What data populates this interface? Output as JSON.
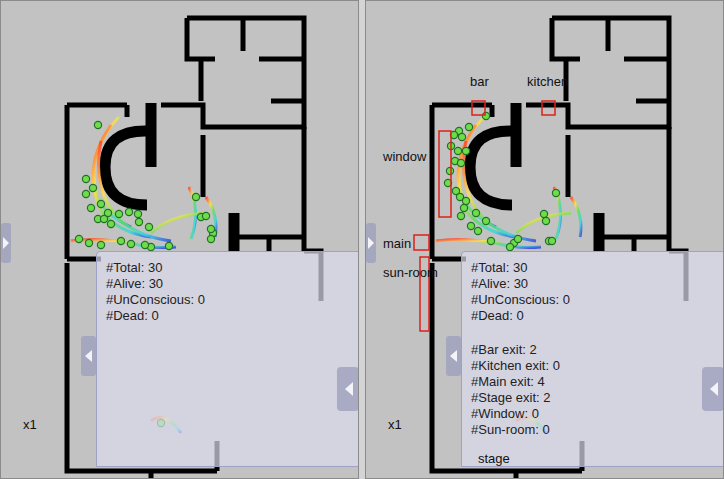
{
  "panels": [
    {
      "speed": "x1",
      "labels": [],
      "stats": [
        "#Total: 30",
        "#Alive: 30",
        "#UnConscious: 0",
        "#Dead: 0"
      ],
      "exit_stats": []
    },
    {
      "speed": "x1",
      "labels": [
        "bar",
        "kitchen",
        "window",
        "main",
        "sun-room",
        "stage"
      ],
      "stats": [
        "#Total: 30",
        "#Alive: 30",
        "#UnConscious: 0",
        "#Dead: 0"
      ],
      "exit_stats": [
        "#Bar exit: 2",
        "#Kitchen exit: 0",
        "#Main exit: 4",
        "#Stage exit: 2",
        "#Window: 0",
        "#Sun-room: 0"
      ]
    }
  ]
}
